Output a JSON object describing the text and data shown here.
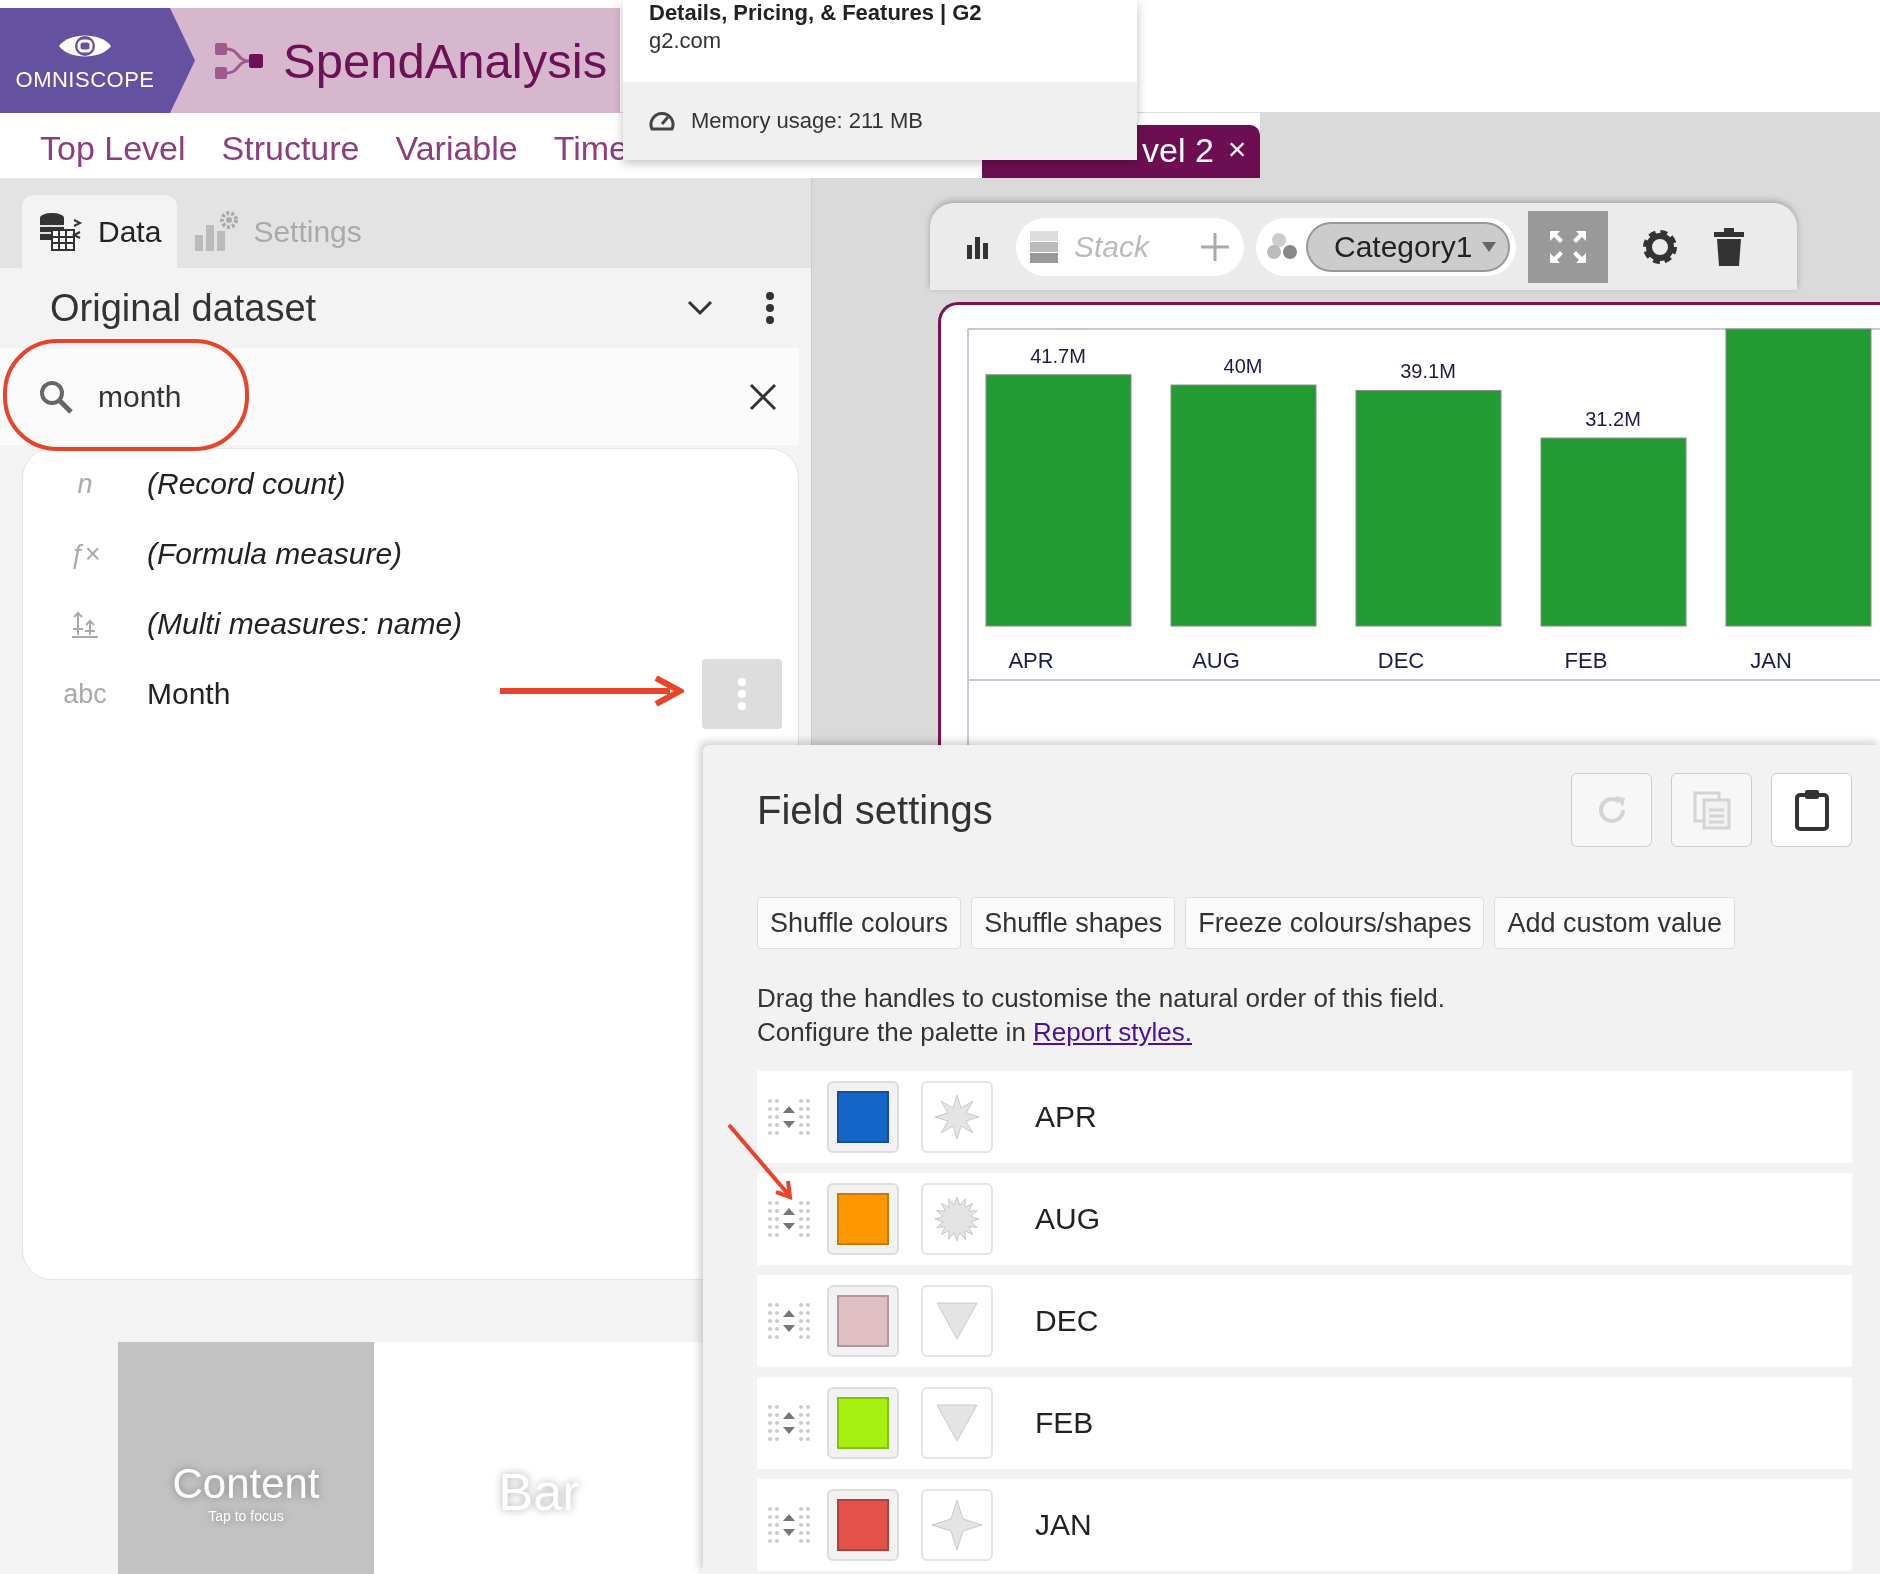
{
  "app": {
    "logo": "OMNISCOPE",
    "title": "SpendAnalysis"
  },
  "tooltip": {
    "title": "Details, Pricing, & Features | G2",
    "url": "g2.com",
    "memory": "Memory usage: 211 MB"
  },
  "tabs": [
    {
      "label": "Top Level",
      "selected": false
    },
    {
      "label": "Structure",
      "selected": false
    },
    {
      "label": "Variable",
      "selected": false
    },
    {
      "label": "Time",
      "selected": false
    },
    {
      "label": "vel 2",
      "selected": true,
      "close": "×"
    }
  ],
  "panel": {
    "tabs": [
      {
        "label": "Data",
        "kind": "data",
        "selected": true
      },
      {
        "label": "Settings",
        "kind": "settings",
        "selected": false
      }
    ],
    "source": "Original dataset",
    "search": {
      "value": "month"
    },
    "fields": [
      {
        "kind": "count",
        "type_label": "n",
        "name": "(Record count)",
        "italic": true,
        "hovered": false
      },
      {
        "kind": "formula",
        "type_label": "ƒ×",
        "name": "(Formula measure)",
        "italic": true,
        "hovered": false
      },
      {
        "kind": "multi",
        "name": "(Multi measures: name)",
        "italic": true,
        "hovered": false
      },
      {
        "kind": "text",
        "type_label": "abc",
        "name": "Month",
        "italic": false,
        "hovered": true
      }
    ],
    "tiles": [
      {
        "kind": "focused",
        "title": "Content",
        "hint": "Tap to focus"
      },
      {
        "kind": "plain",
        "title": "Bar"
      }
    ]
  },
  "chart_toolbar": {
    "stack_placeholder": "Stack",
    "category": "Category1",
    "fullscreen_on": true
  },
  "chart": {
    "chart_data": {
      "type": "bar",
      "categories": [
        "APR",
        "AUG",
        "DEC",
        "FEB",
        "JAN"
      ],
      "values": [
        41.7,
        40,
        39.1,
        31.2,
        49.3
      ],
      "ylim": [
        0,
        49.3
      ],
      "value_labels": [
        "41.7M",
        "40M",
        "39.1M",
        "31.2M",
        null
      ],
      "color": "#239b33"
    }
  },
  "field_settings": {
    "title": "Field settings",
    "actions": [
      {
        "kind": "reset",
        "disabled": true
      },
      {
        "kind": "copy",
        "disabled": true
      },
      {
        "kind": "paste",
        "disabled": false
      }
    ],
    "buttons": [
      "Shuffle colours",
      "Shuffle shapes",
      "Freeze colours/shapes",
      "Add custom value"
    ],
    "description": "Drag the handles to customise the natural order of this field.",
    "palette_text": "Configure the palette in",
    "palette_link": "Report styles.",
    "values": [
      {
        "label": "APR",
        "color": "#1565c8",
        "kind": "star"
      },
      {
        "label": "AUG",
        "color": "#ff9800",
        "kind": "burst"
      },
      {
        "label": "DEC",
        "color": "#dfbfc2",
        "kind": "triangle"
      },
      {
        "label": "FEB",
        "color": "#a6f010",
        "kind": "triangle"
      },
      {
        "label": "JAN",
        "color": "#e2514a",
        "kind": "sparkle"
      }
    ]
  }
}
